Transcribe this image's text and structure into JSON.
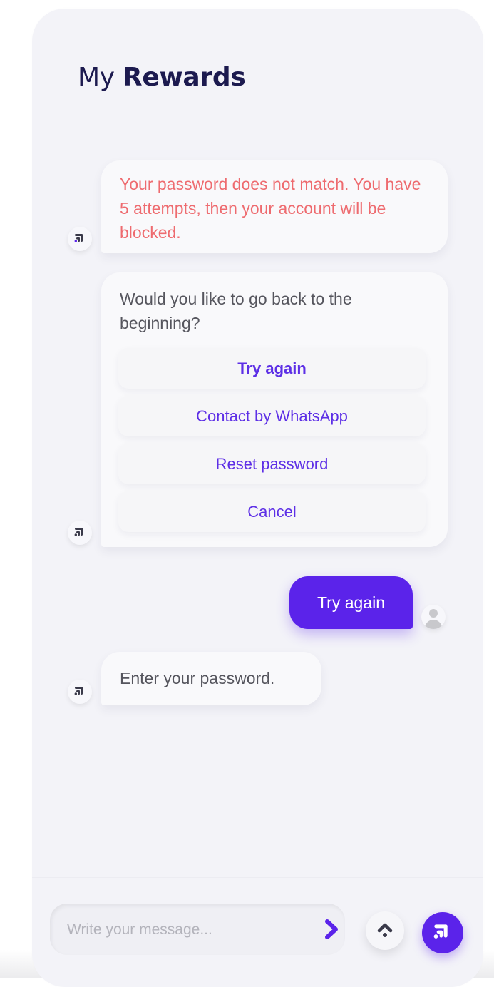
{
  "header": {
    "title_prefix": "My",
    "title_bold": "Rewards"
  },
  "messages": {
    "error": "Your password does not match. You have 5 attempts, then your account will be blocked.",
    "question": "Would you like to go back to the beginning?",
    "options": [
      "Try again",
      "Contact by WhatsApp",
      "Reset password",
      "Cancel"
    ],
    "user_reply": "Try again",
    "prompt": "Enter your password."
  },
  "composer": {
    "placeholder": "Write your message..."
  },
  "icons": {
    "bot_avatar": "chatbot-logo-icon",
    "user_avatar": "user-avatar-icon",
    "send": "chevron-right-icon",
    "scroll_up": "chevron-up-icon",
    "bot_button": "chatbot-logo-icon"
  },
  "colors": {
    "accent": "#5b23ea",
    "error_text": "#ee6b6f",
    "title": "#1c1a4f",
    "background": "#f3f3f8"
  }
}
